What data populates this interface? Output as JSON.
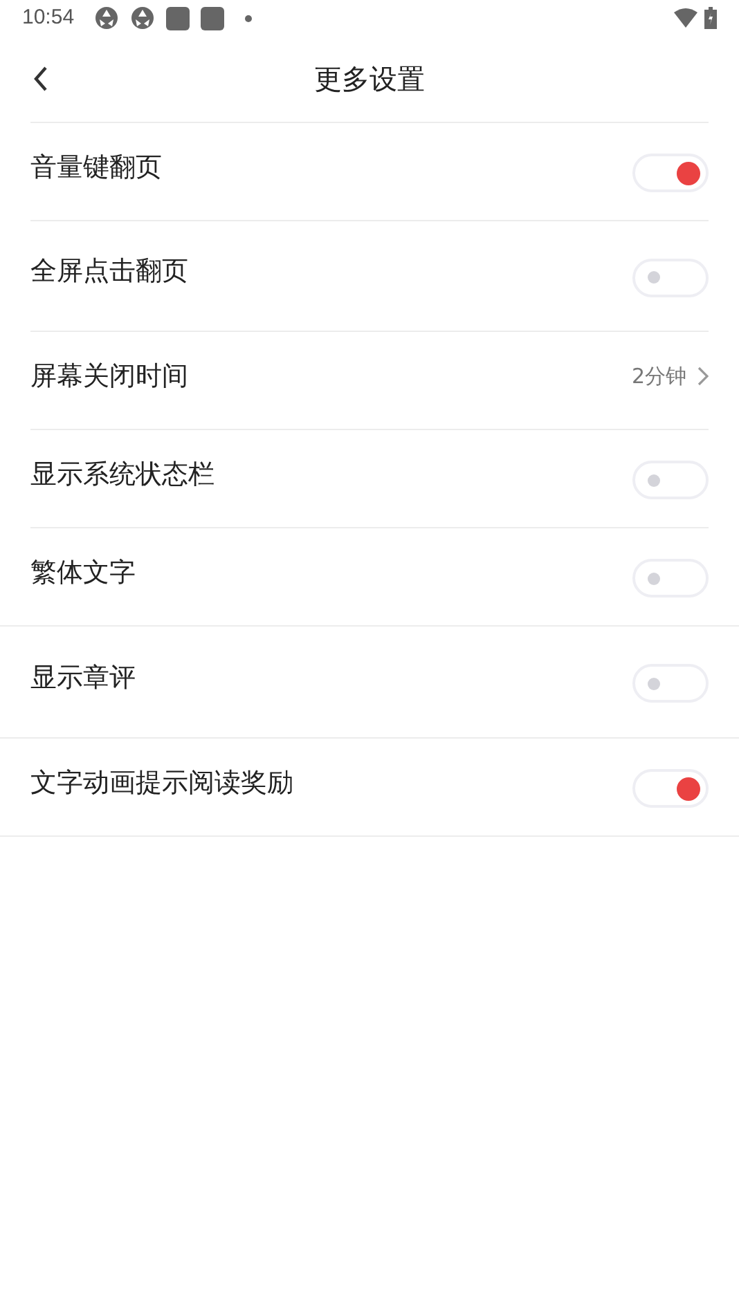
{
  "status_bar": {
    "time": "10:54"
  },
  "header": {
    "title": "更多设置"
  },
  "sections": [
    {
      "rows": [
        {
          "kind": "toggle",
          "label": "音量键翻页",
          "on": true
        },
        {
          "kind": "toggle",
          "label": "全屏点击翻页",
          "on": false
        },
        {
          "kind": "value",
          "label": "屏幕关闭时间",
          "value": "2分钟"
        },
        {
          "kind": "toggle",
          "label": "显示系统状态栏",
          "on": false
        },
        {
          "kind": "toggle",
          "label": "繁体文字",
          "on": false
        }
      ]
    },
    {
      "rows": [
        {
          "kind": "toggle",
          "label": "显示章评",
          "on": false
        }
      ]
    },
    {
      "rows": [
        {
          "kind": "toggle",
          "label": "文字动画提示阅读奖励",
          "on": true
        }
      ]
    }
  ]
}
